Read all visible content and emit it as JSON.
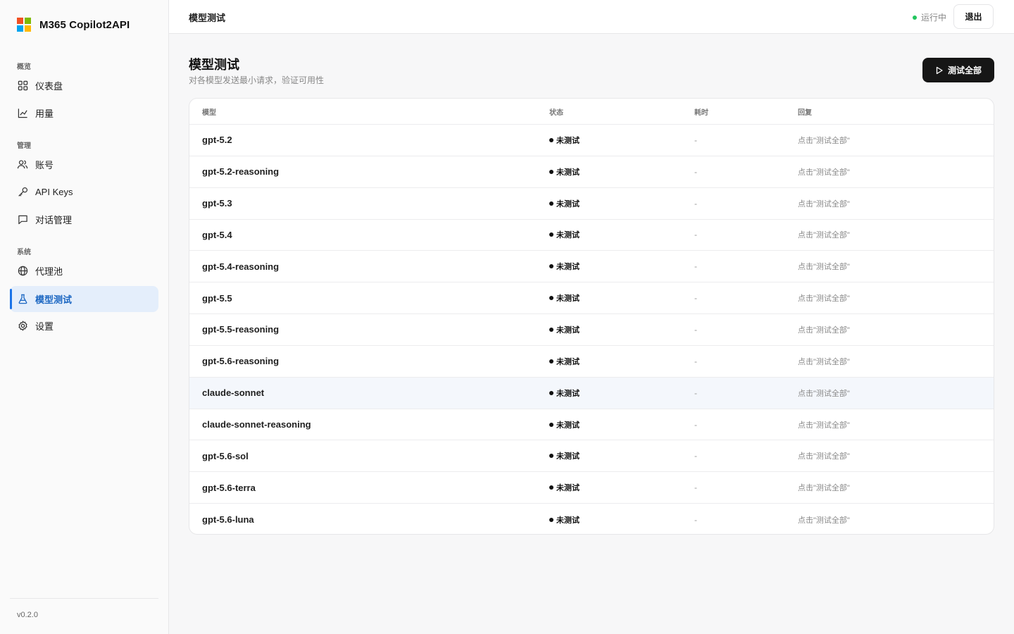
{
  "app": {
    "name": "M365 Copilot2API",
    "version": "v0.2.0",
    "logo_colors": [
      "#f25022",
      "#7fba00",
      "#00a4ef",
      "#ffb900"
    ]
  },
  "sidebar": {
    "sections": [
      {
        "label": "概览",
        "items": [
          {
            "label": "仪表盘",
            "icon": "dashboard-icon"
          },
          {
            "label": "用量",
            "icon": "chart-line-icon"
          }
        ]
      },
      {
        "label": "管理",
        "items": [
          {
            "label": "账号",
            "icon": "users-icon"
          },
          {
            "label": "API Keys",
            "icon": "key-icon"
          },
          {
            "label": "对话管理",
            "icon": "chat-icon"
          }
        ]
      },
      {
        "label": "系统",
        "items": [
          {
            "label": "代理池",
            "icon": "globe-icon"
          },
          {
            "label": "模型测试",
            "icon": "flask-icon",
            "active": true
          },
          {
            "label": "设置",
            "icon": "gear-icon"
          }
        ]
      }
    ]
  },
  "topbar": {
    "title": "模型测试",
    "status_text": "运行中",
    "status_color": "#22c55e",
    "logout_label": "退出"
  },
  "main": {
    "title": "模型测试",
    "subtitle": "对各模型发送最小请求，验证可用性",
    "test_all_label": "测试全部",
    "table": {
      "columns": [
        "模型",
        "状态",
        "耗时",
        "回复"
      ],
      "rows": [
        {
          "model": "gpt-5.2",
          "status": "未测试",
          "time": "-",
          "reply": "点击\"测试全部\""
        },
        {
          "model": "gpt-5.2-reasoning",
          "status": "未测试",
          "time": "-",
          "reply": "点击\"测试全部\""
        },
        {
          "model": "gpt-5.3",
          "status": "未测试",
          "time": "-",
          "reply": "点击\"测试全部\""
        },
        {
          "model": "gpt-5.4",
          "status": "未测试",
          "time": "-",
          "reply": "点击\"测试全部\""
        },
        {
          "model": "gpt-5.4-reasoning",
          "status": "未测试",
          "time": "-",
          "reply": "点击\"测试全部\""
        },
        {
          "model": "gpt-5.5",
          "status": "未测试",
          "time": "-",
          "reply": "点击\"测试全部\""
        },
        {
          "model": "gpt-5.5-reasoning",
          "status": "未测试",
          "time": "-",
          "reply": "点击\"测试全部\""
        },
        {
          "model": "gpt-5.6-reasoning",
          "status": "未测试",
          "time": "-",
          "reply": "点击\"测试全部\""
        },
        {
          "model": "claude-sonnet",
          "status": "未测试",
          "time": "-",
          "reply": "点击\"测试全部\"",
          "hover": true
        },
        {
          "model": "claude-sonnet-reasoning",
          "status": "未测试",
          "time": "-",
          "reply": "点击\"测试全部\""
        },
        {
          "model": "gpt-5.6-sol",
          "status": "未测试",
          "time": "-",
          "reply": "点击\"测试全部\""
        },
        {
          "model": "gpt-5.6-terra",
          "status": "未测试",
          "time": "-",
          "reply": "点击\"测试全部\""
        },
        {
          "model": "gpt-5.6-luna",
          "status": "未测试",
          "time": "-",
          "reply": "点击\"测试全部\""
        }
      ]
    }
  }
}
